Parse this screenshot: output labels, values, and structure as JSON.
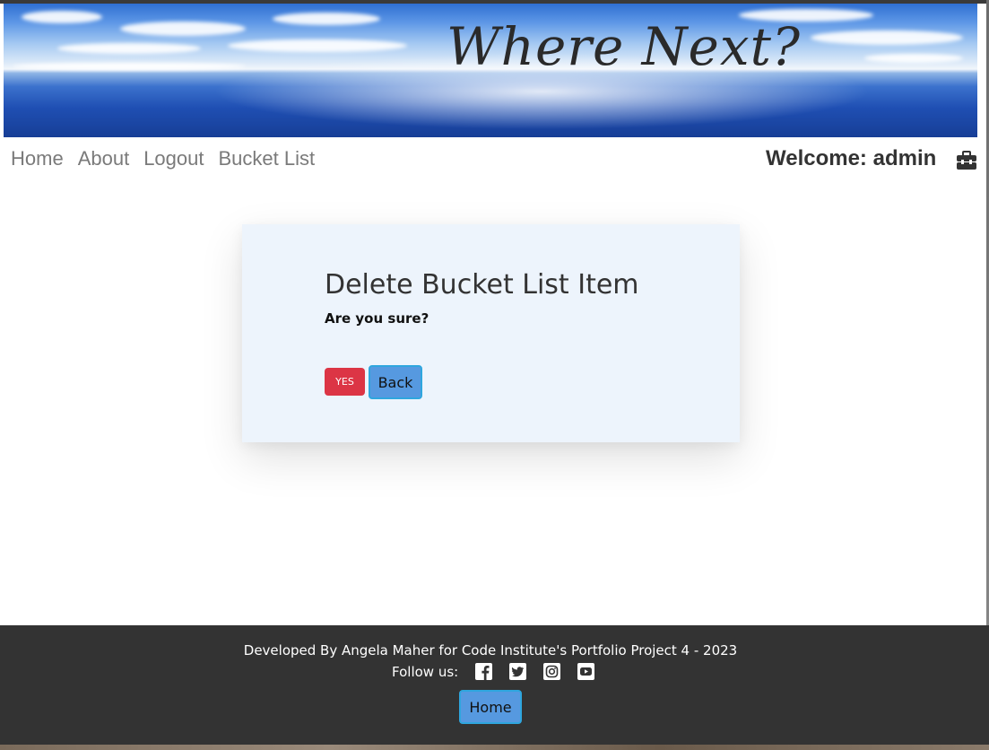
{
  "banner": {
    "title": "Where Next?"
  },
  "nav": {
    "items": [
      {
        "label": "Home"
      },
      {
        "label": "About"
      },
      {
        "label": "Logout"
      },
      {
        "label": "Bucket List"
      }
    ],
    "welcome": "Welcome: admin",
    "user_icon": "toolbox-icon"
  },
  "dialog": {
    "title": "Delete Bucket List Item",
    "question": "Are you sure?",
    "yes_label": "YES",
    "back_label": "Back"
  },
  "footer": {
    "credit": "Developed By Angela Maher for Code Institute's Portfolio Project 4 - 2023",
    "follow_label": "Follow us:",
    "social_icons": [
      "facebook-icon",
      "twitter-icon",
      "instagram-icon",
      "youtube-icon"
    ],
    "home_label": "Home"
  },
  "colors": {
    "danger": "#dc3545",
    "primary": "#5699e0",
    "card_bg": "#edf4fc",
    "footer_bg": "#333333"
  }
}
